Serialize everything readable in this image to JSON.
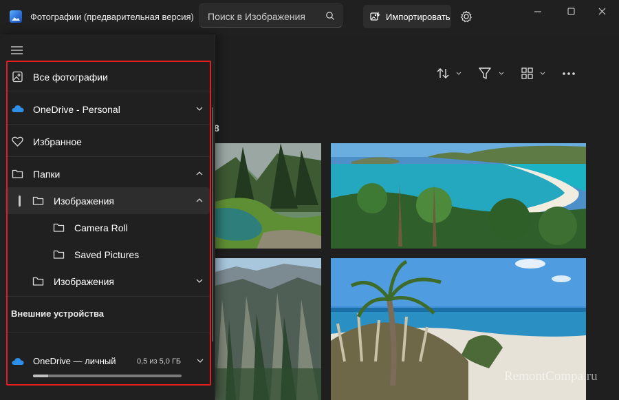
{
  "window": {
    "title": "Фотографии (предварительная версия)",
    "search_placeholder": "Поиск в Изображения",
    "import_label": "Импортировать"
  },
  "nav": {
    "items": [
      {
        "label": "Все фотографии",
        "icon": "photo-gallery-icon"
      },
      {
        "label": "OneDrive - Personal",
        "icon": "onedrive-cloud-icon"
      },
      {
        "label": "Избранное",
        "icon": "heart-icon"
      },
      {
        "label": "Папки",
        "icon": "folder-icon"
      },
      {
        "label": "Изображения",
        "icon": "folder-icon"
      },
      {
        "label": "Camera Roll",
        "icon": "folder-icon"
      },
      {
        "label": "Saved Pictures",
        "icon": "folder-icon"
      },
      {
        "label": "Изображения",
        "icon": "folder-icon"
      }
    ],
    "section_title": "Внешние устройства",
    "onedrive": {
      "label": "OneDrive — личный",
      "quota": "0,5 из 5,0 ГБ",
      "used_fraction": 0.1
    }
  },
  "gallery": {
    "partial_date_text": "8"
  },
  "watermark": "RemontCompa.ru",
  "colors": {
    "accent_highlight": "#e02020",
    "nav_background": "#202020",
    "onedrive_blue": "#2f8fe8"
  }
}
